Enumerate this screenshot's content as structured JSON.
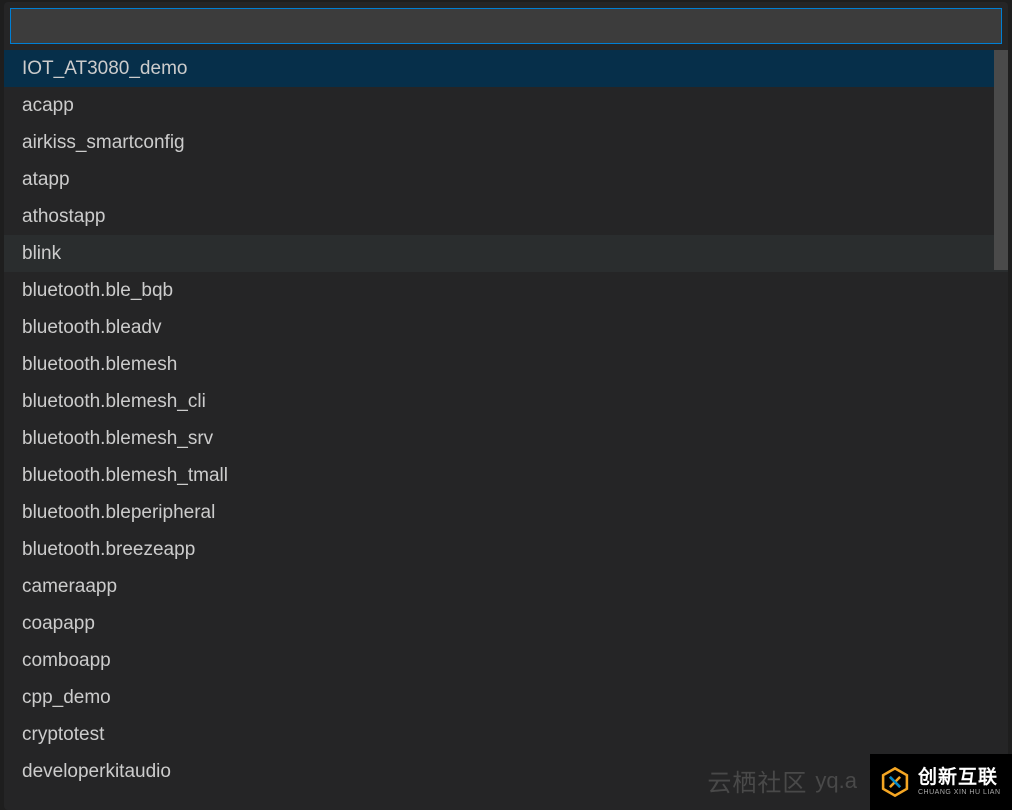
{
  "input": {
    "value": ""
  },
  "items": [
    {
      "label": "IOT_AT3080_demo",
      "state": "selected"
    },
    {
      "label": "acapp",
      "state": ""
    },
    {
      "label": "airkiss_smartconfig",
      "state": ""
    },
    {
      "label": "atapp",
      "state": ""
    },
    {
      "label": "athostapp",
      "state": ""
    },
    {
      "label": "blink",
      "state": "hovered"
    },
    {
      "label": "bluetooth.ble_bqb",
      "state": ""
    },
    {
      "label": "bluetooth.bleadv",
      "state": ""
    },
    {
      "label": "bluetooth.blemesh",
      "state": ""
    },
    {
      "label": "bluetooth.blemesh_cli",
      "state": ""
    },
    {
      "label": "bluetooth.blemesh_srv",
      "state": ""
    },
    {
      "label": "bluetooth.blemesh_tmall",
      "state": ""
    },
    {
      "label": "bluetooth.bleperipheral",
      "state": ""
    },
    {
      "label": "bluetooth.breezeapp",
      "state": ""
    },
    {
      "label": "cameraapp",
      "state": ""
    },
    {
      "label": "coapapp",
      "state": ""
    },
    {
      "label": "comboapp",
      "state": ""
    },
    {
      "label": "cpp_demo",
      "state": ""
    },
    {
      "label": "cryptotest",
      "state": ""
    },
    {
      "label": "developerkitaudio",
      "state": ""
    }
  ],
  "watermark": {
    "brand": "云栖社区",
    "domain": "yq.a"
  },
  "cornerLogo": {
    "main": "创新互联",
    "sub": "CHUANG XIN HU LIAN"
  }
}
